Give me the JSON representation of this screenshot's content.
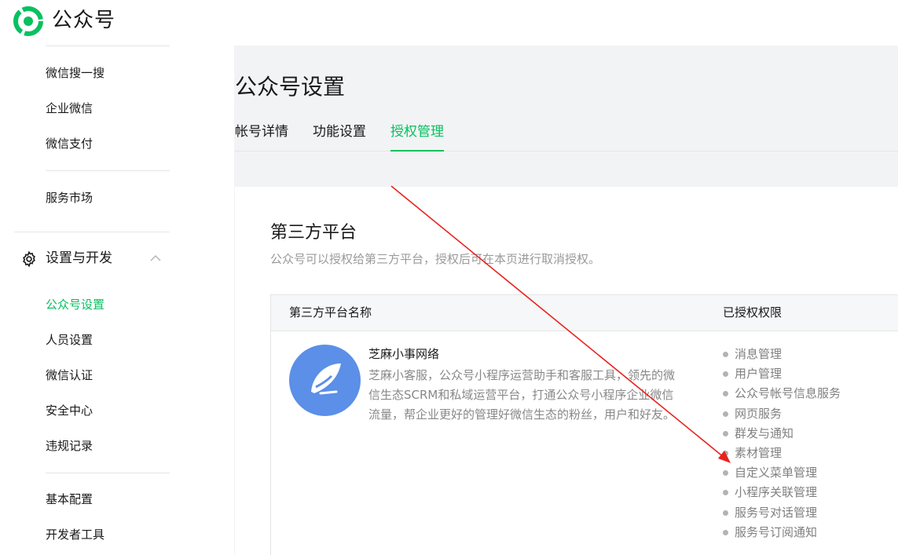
{
  "app": {
    "brand": "公众号"
  },
  "sidebar": {
    "top_items": [
      {
        "label": "微信搜一搜"
      },
      {
        "label": "企业微信"
      },
      {
        "label": "微信支付"
      }
    ],
    "market": {
      "label": "服务市场"
    },
    "section": {
      "label": "设置与开发",
      "items": [
        {
          "label": "公众号设置",
          "active": true
        },
        {
          "label": "人员设置"
        },
        {
          "label": "微信认证"
        },
        {
          "label": "安全中心"
        },
        {
          "label": "违规记录"
        }
      ]
    },
    "bottom_items": [
      {
        "label": "基本配置"
      },
      {
        "label": "开发者工具"
      }
    ]
  },
  "main": {
    "title": "公众号设置",
    "tabs": [
      {
        "label": "帐号详情"
      },
      {
        "label": "功能设置"
      },
      {
        "label": "授权管理",
        "active": true
      }
    ]
  },
  "card": {
    "title": "第三方平台",
    "description": "公众号可以授权给第三方平台，授权后可在本页进行取消授权。",
    "table": {
      "headers": {
        "name": "第三方平台名称",
        "permissions": "已授权权限"
      },
      "rows": [
        {
          "name": "芝麻小事网络",
          "description": "芝麻小客服，公众号小程序运营助手和客服工具，领先的微信生态SCRM和私域运营平台，打通公众号小程序企业微信流量，帮企业更好的管理好微信生态的粉丝，用户和好友。",
          "permissions": [
            "消息管理",
            "用户管理",
            "公众号帐号信息服务",
            "网页服务",
            "群发与通知",
            "素材管理",
            "自定义菜单管理",
            "小程序关联管理",
            "服务号对话管理",
            "服务号订阅通知"
          ]
        }
      ]
    }
  },
  "colors": {
    "accent": "#07c160",
    "avatar_blue": "#5b8fe8",
    "annotation_arrow": "#e8231e"
  }
}
